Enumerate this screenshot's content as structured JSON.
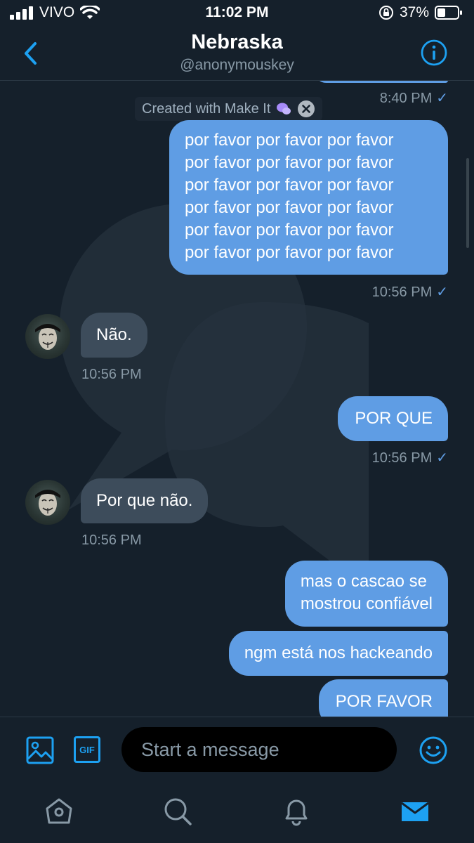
{
  "status_bar": {
    "carrier": "VIVO",
    "time": "11:02 PM",
    "battery": "37%"
  },
  "header": {
    "title": "Nebraska",
    "handle": "@anonymouskey",
    "back_icon": "chevron-left-icon",
    "info_icon": "info-icon"
  },
  "watermark": {
    "label": "Created with Make It"
  },
  "messages": [
    {
      "side": "sent",
      "text": "",
      "time": "8:40 PM"
    },
    {
      "side": "sent",
      "lines": [
        "por favor por favor por favor",
        "por favor por favor por favor",
        "por favor por favor por favor",
        "por favor por favor por favor",
        "por favor por favor por favor",
        "por favor por favor por favor"
      ],
      "time": "10:56 PM"
    },
    {
      "side": "received",
      "text": "Não.",
      "time": "10:56 PM"
    },
    {
      "side": "sent",
      "text": "POR QUE",
      "time": "10:56 PM"
    },
    {
      "side": "received",
      "text": "Por que não.",
      "time": "10:56 PM"
    },
    {
      "side": "sent",
      "lines": [
        "mas o cascao se",
        "mostrou confiável"
      ]
    },
    {
      "side": "sent",
      "text": "ngm está nos hackeando"
    },
    {
      "side": "sent",
      "text": "POR FAVOR"
    }
  ],
  "composer": {
    "placeholder": "Start a message",
    "image_icon": "image-icon",
    "gif_label": "GIF",
    "emoji_icon": "emoji-icon"
  },
  "tabbar": {
    "items": [
      "home-icon",
      "search-icon",
      "notifications-icon",
      "messages-icon"
    ],
    "active": "messages-icon"
  },
  "colors": {
    "background": "#15202b",
    "sent_bubble": "#5f9de4",
    "received_bubble": "#3d4c5b",
    "accent": "#1da1f2",
    "muted_text": "#8899a6"
  }
}
